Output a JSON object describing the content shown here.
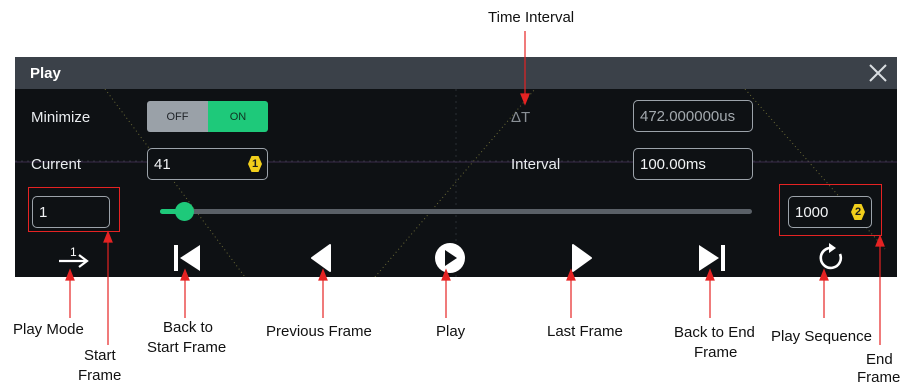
{
  "panel": {
    "title": "Play",
    "minimize_label": "Minimize",
    "toggle": {
      "off": "OFF",
      "on": "ON",
      "state": "ON"
    },
    "current_label": "Current",
    "current_value": "41",
    "current_badge": "1",
    "delta_t_label": "ΔT",
    "delta_t_value": "472.000000us",
    "interval_label": "Interval",
    "interval_value": "100.00ms",
    "start_frame_value": "1",
    "end_frame_value": "1000",
    "end_badge": "2",
    "play_mode_glyph": "1",
    "slider_fraction": 0.04
  },
  "controls": {
    "play_mode": "play-mode-icon",
    "back_to_start": "skip-to-start-icon",
    "previous_frame": "previous-frame-icon",
    "play": "play-icon",
    "last_frame": "next-frame-icon",
    "back_to_end": "skip-to-end-icon",
    "play_sequence": "repeat-icon"
  },
  "annotations": {
    "time_interval": "Time Interval",
    "play_mode": "Play Mode",
    "start_frame_1": "Start",
    "start_frame_2": "Frame",
    "back_to_start_1": "Back to",
    "back_to_start_2": "Start Frame",
    "previous_frame": "Previous Frame",
    "play": "Play",
    "last_frame": "Last Frame",
    "back_to_end_1": "Back to End",
    "back_to_end_2": "Frame",
    "play_sequence": "Play Sequence",
    "end_frame_1": "End",
    "end_frame_2": "Frame"
  },
  "colors": {
    "panel_bg": "#0e1114",
    "title_bar": "#3b4149",
    "accent_green": "#1ec97a",
    "badge_yellow": "#f2cf1b",
    "annotation_red": "#e52323"
  }
}
